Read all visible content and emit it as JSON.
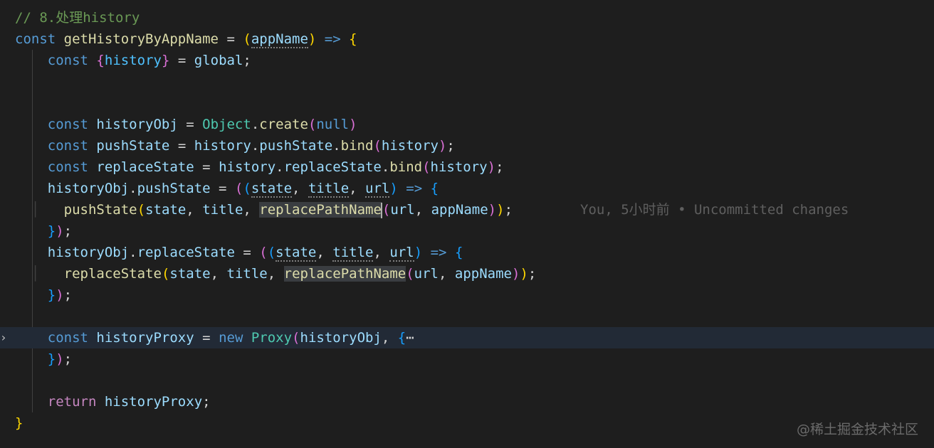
{
  "editor": {
    "comment": "// 8.处理history",
    "func_name": "getHistoryByAppName",
    "param": "appName",
    "global_var": "history",
    "global_obj": "global",
    "history_obj": "historyObj",
    "object_word": "Object",
    "create_word": "create",
    "null_word": "null",
    "push_state": "pushState",
    "replace_state": "replaceState",
    "history_word": "history",
    "bind_word": "bind",
    "state_word": "state",
    "title_word": "title",
    "url_word": "url",
    "replace_path_name": "replacePathName",
    "history_proxy": "historyProxy",
    "proxy_class": "Proxy",
    "collapsed_marker": "⋯",
    "keywords": {
      "const": "const",
      "new": "new",
      "return": "return"
    },
    "fold_icon": "chevron-right-icon"
  },
  "blame": {
    "text": "You, 5小时前 • Uncommitted changes"
  },
  "watermark": {
    "text": "@稀土掘金技术社区"
  }
}
